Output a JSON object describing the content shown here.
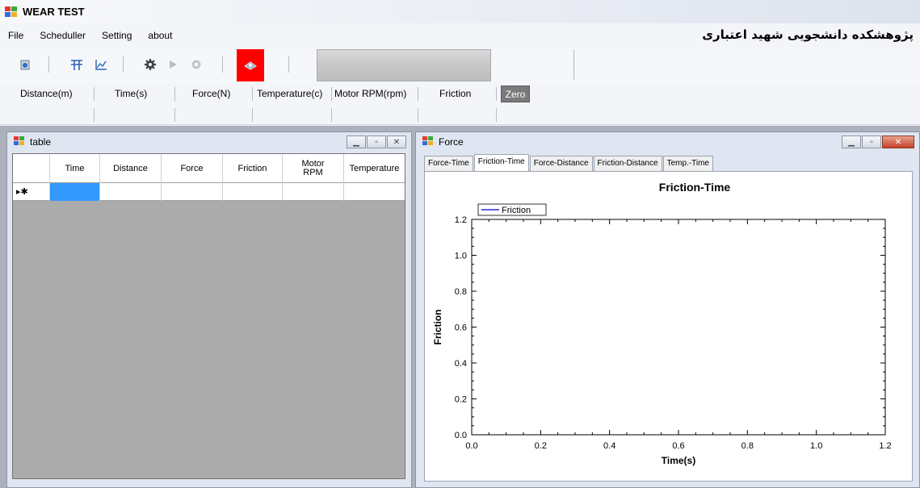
{
  "window": {
    "title": "WEAR TEST"
  },
  "menu": {
    "items": [
      "File",
      "Scheduller",
      "Setting",
      "about"
    ]
  },
  "institute": "پژوهشکده دانشجویی شهید اعتباری",
  "toolbar": {
    "icons": [
      "connect-icon",
      "table-icon",
      "chart-icon",
      "settings-gear-icon",
      "play-icon",
      "stop-icon",
      "sensor-icon"
    ],
    "accent_red": "#ff0000"
  },
  "readouts": {
    "distance": "Distance(m)",
    "time": "Time(s)",
    "force": "Force(N)",
    "temperature": "Temperature(c)",
    "motor_rpm": "Motor RPM(rpm)",
    "friction": "Friction",
    "zero_button": "Zero"
  },
  "table_window": {
    "title": "table",
    "columns": [
      "Time",
      "Distance",
      "Force",
      "Friction",
      "Motor RPM",
      "Temperature"
    ],
    "new_row_marker": "▸✱"
  },
  "chart_window": {
    "title": "Force",
    "tabs": [
      "Force-Time",
      "Friction-Time",
      "Force-Distance",
      "Friction-Distance",
      "Temp.-Time"
    ],
    "active_tab": "Friction-Time"
  },
  "chart_data": {
    "type": "line",
    "title": "Friction-Time",
    "xlabel": "Time(s)",
    "ylabel": "Friction",
    "xlim": [
      0,
      1.2
    ],
    "ylim": [
      0,
      1.2
    ],
    "x_ticks": [
      "0.0",
      "0.2",
      "0.4",
      "0.6",
      "0.8",
      "1.0",
      "1.2"
    ],
    "y_ticks": [
      "0.0",
      "0.2",
      "0.4",
      "0.6",
      "0.8",
      "1.0",
      "1.2"
    ],
    "series": [
      {
        "name": "Friction",
        "color": "#0000cc",
        "values": []
      }
    ],
    "legend": "top-left",
    "grid": false
  }
}
